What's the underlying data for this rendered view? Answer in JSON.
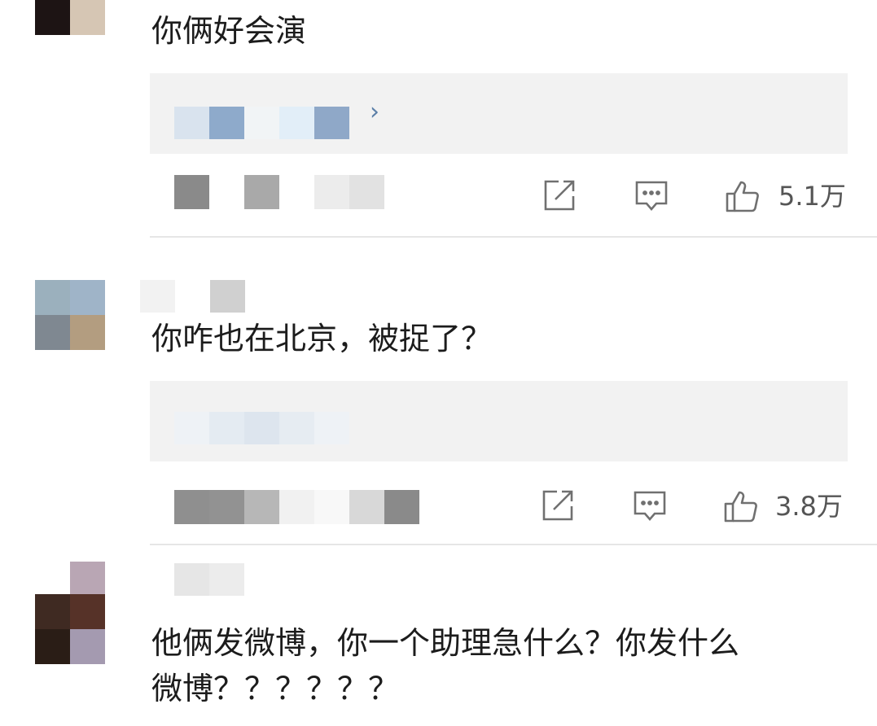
{
  "comments": [
    {
      "text": "你俩好会演",
      "likes": "5.1万",
      "reply_link": "共107条回复 >"
    },
    {
      "text": "你咋也在北京，被捉了？",
      "likes": "3.8万"
    },
    {
      "text": "他俩发微博，你一个助理急什么？你发什么\n微博？？？？？？"
    }
  ],
  "icons": {
    "share": "share-icon",
    "comment": "comment-icon",
    "like": "thumbs-up-icon"
  },
  "colors": {
    "reply_box_bg": "#f2f2f2",
    "divider": "#e6e6e6",
    "text": "#1c1c1c",
    "meta": "#555555",
    "link": "#5b7fa8"
  }
}
